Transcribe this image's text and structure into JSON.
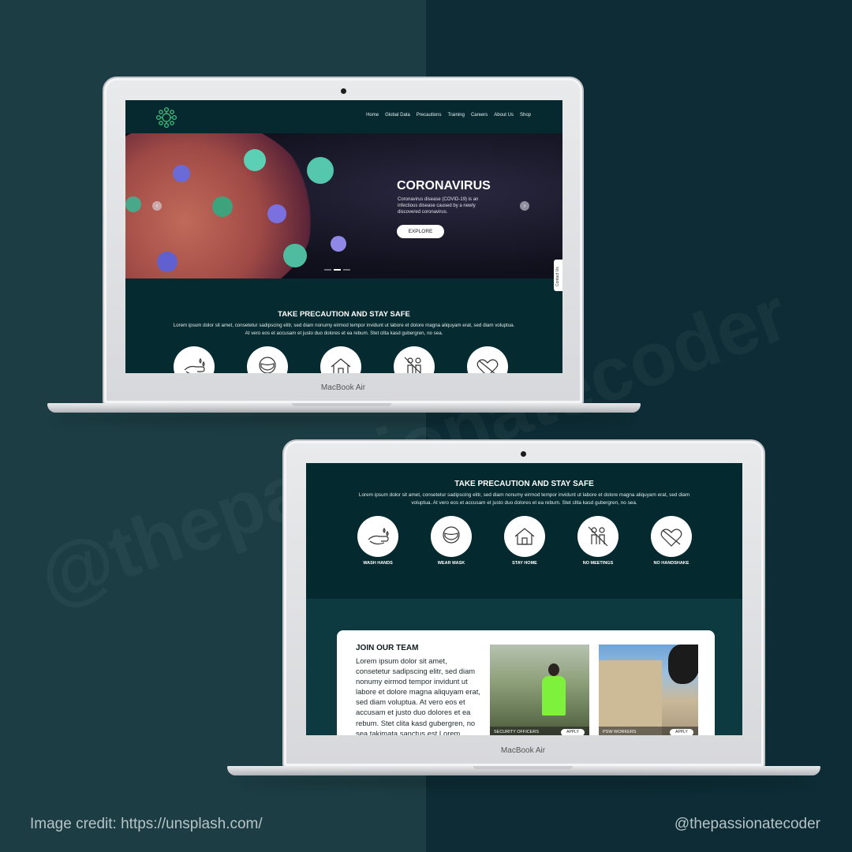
{
  "watermark": "@thepassionatecoder",
  "footer": {
    "credit": "Image credit: https://unsplash.com/",
    "handle": "@thepassionatecoder"
  },
  "device": {
    "brand": "MacBook Air"
  },
  "site": {
    "nav": [
      "Home",
      "Global Data",
      "Precautions",
      "Training",
      "Careers",
      "About Us",
      "Shop"
    ],
    "hero": {
      "title": "CORONAVIRUS",
      "text": "Coronavirus disease (COVID-19) is an infectious disease caused by a newly discovered coronavirus.",
      "button": "EXPLORE",
      "contact_tab": "Contact Us"
    },
    "precautions": {
      "title": "TAKE PRECAUTION AND STAY SAFE",
      "text": "Lorem ipsum dolor sit amet, consetetur sadipscing elitr, sed diam nonumy eirmod tempor invidunt ut labore et dolore magna aliquyam erat, sed diam voluptua. At vero eos et accusam et justo duo dolores et ea rebum. Stet clita kasd gubergren, no sea.",
      "items": [
        {
          "label": "WASH HANDS",
          "icon": "wash-hands-icon"
        },
        {
          "label": "WEAR MASK",
          "icon": "mask-icon"
        },
        {
          "label": "STAY HOME",
          "icon": "home-icon"
        },
        {
          "label": "NO MEETINGS",
          "icon": "no-meetings-icon"
        },
        {
          "label": "NO HANDSHAKE",
          "icon": "no-handshake-icon"
        }
      ]
    },
    "team": {
      "title": "JOIN OUR TEAM",
      "text": "Lorem ipsum dolor sit amet, consetetur sadipscing elitr, sed diam nonumy eirmod tempor invidunt ut labore et dolore magna aliquyam erat, sed diam voluptua. At vero eos et accusam et justo duo dolores et ea rebum. Stet clita kasd gubergren, no sea takimata sanctus est Lorem",
      "jobs": [
        {
          "title": "SECURITY OFFICERS",
          "apply": "APPLY"
        },
        {
          "title": "PSW WORKERS",
          "apply": "APPLY"
        }
      ]
    }
  },
  "colors": {
    "site_bg": "#052a30",
    "accent_green": "#3fbf7a",
    "bg_left": "#1c3d44",
    "bg_right": "#0d2c35"
  }
}
